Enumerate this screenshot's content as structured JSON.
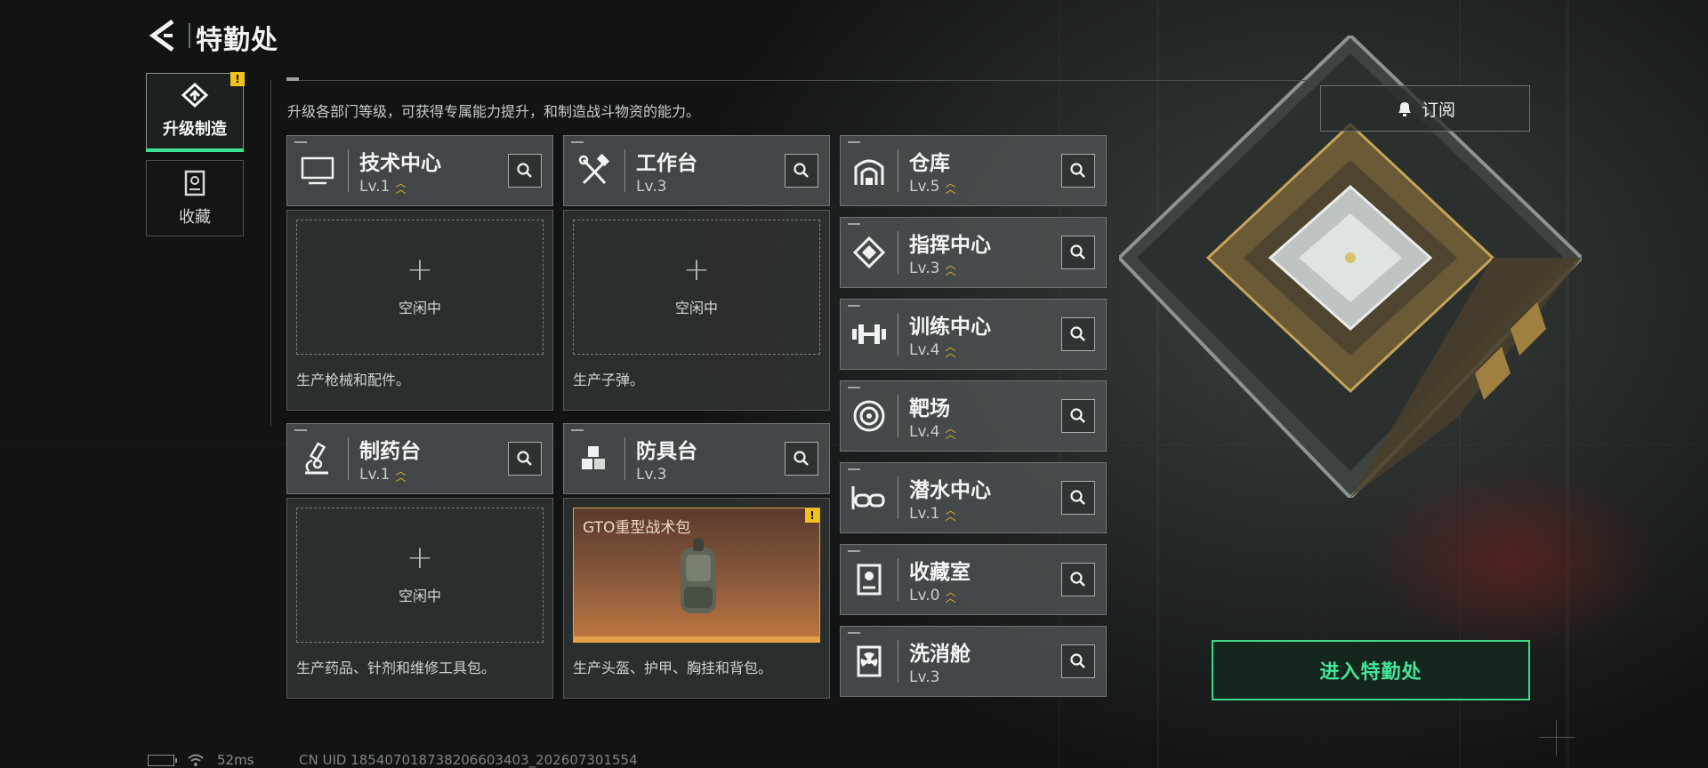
{
  "header": {
    "title": "特勤处"
  },
  "sidebar": {
    "tabs": [
      {
        "label": "升级制造",
        "active": true,
        "alert": true
      },
      {
        "label": "收藏",
        "active": false,
        "alert": false
      }
    ]
  },
  "intro": "升级各部门等级，可获得专属能力提升，和制造战斗物资的能力。",
  "subscribe_label": "订阅",
  "enter_label": "进入特勤处",
  "workshops": [
    {
      "name": "技术中心",
      "level": "Lv.1",
      "upgradable": true,
      "slot_state": "空闲中",
      "description": "生产枪械和配件。",
      "icon": "monitor-icon"
    },
    {
      "name": "工作台",
      "level": "Lv.3",
      "upgradable": false,
      "slot_state": "空闲中",
      "description": "生产子弹。",
      "icon": "hammer-wrench-icon"
    },
    {
      "name": "制药台",
      "level": "Lv.1",
      "upgradable": true,
      "slot_state": "空闲中",
      "description": "生产药品、针剂和维修工具包。",
      "icon": "microscope-icon"
    },
    {
      "name": "防具台",
      "level": "Lv.3",
      "upgradable": false,
      "slot_item": "GTO重型战术包",
      "slot_alert": true,
      "description": "生产头盔、护甲、胸挂和背包。",
      "icon": "armor-blocks-icon"
    }
  ],
  "facilities": [
    {
      "name": "仓库",
      "level": "Lv.5",
      "upgradable": true,
      "icon": "warehouse-icon"
    },
    {
      "name": "指挥中心",
      "level": "Lv.3",
      "upgradable": true,
      "icon": "chip-icon"
    },
    {
      "name": "训练中心",
      "level": "Lv.4",
      "upgradable": true,
      "icon": "dumbbell-icon"
    },
    {
      "name": "靶场",
      "level": "Lv.4",
      "upgradable": true,
      "icon": "target-icon"
    },
    {
      "name": "潜水中心",
      "level": "Lv.1",
      "upgradable": true,
      "icon": "diving-goggles-icon"
    },
    {
      "name": "收藏室",
      "level": "Lv.0",
      "upgradable": true,
      "icon": "display-case-icon"
    },
    {
      "name": "洗消舱",
      "level": "Lv.3",
      "upgradable": false,
      "icon": "radiation-icon"
    }
  ],
  "status": {
    "ping": "52ms",
    "uid": "CN UID 18540701873820660340​3_202607301554"
  },
  "colors": {
    "accent": "#3ee08f",
    "upgrade": "#e9b52b",
    "warning": "#f2c21c"
  }
}
